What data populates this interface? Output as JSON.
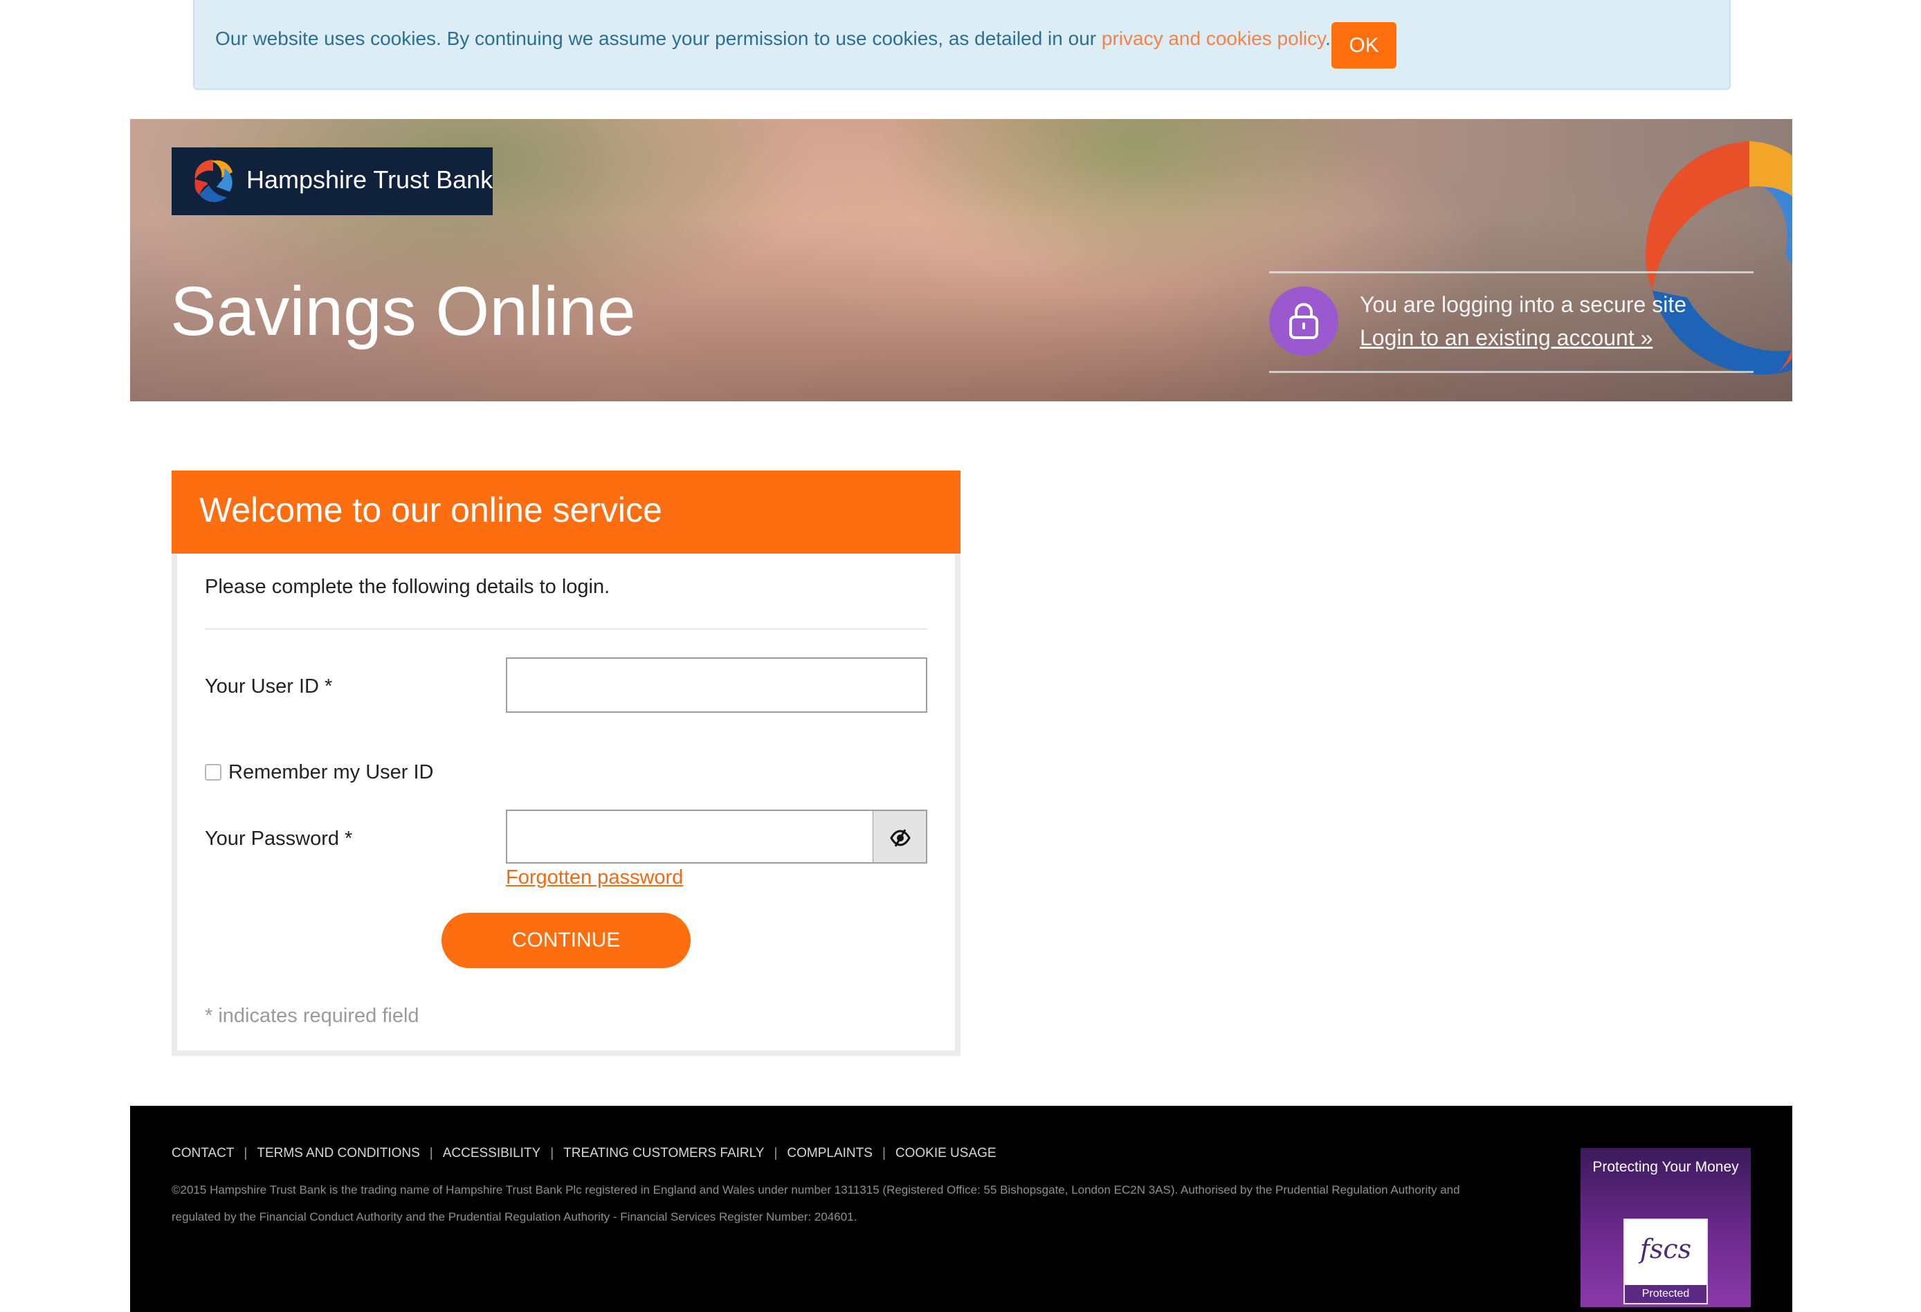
{
  "cookie_banner": {
    "message": "Our website uses cookies. By continuing we assume your permission to use cookies, as detailed in our ",
    "policy_link": "privacy and cookies policy",
    "trailing": ".",
    "ok_label": "OK"
  },
  "hero": {
    "brand_name": "Hampshire Trust Bank",
    "title": "Savings Online",
    "secure_text": "You are logging into a secure site",
    "login_link": "Login to an existing account »"
  },
  "login_panel": {
    "heading": "Welcome to our online service",
    "intro": "Please complete the following details to login.",
    "user_id_label": "Your User ID *",
    "user_id_value": "",
    "remember_label": "Remember my User ID",
    "remember_checked": false,
    "password_label": "Your Password *",
    "password_value": "",
    "forgot_link": "Forgotten password",
    "continue_label": "CONTINUE",
    "required_note": "* indicates required field"
  },
  "footer": {
    "nav": [
      "CONTACT",
      "TERMS AND CONDITIONS",
      "ACCESSIBILITY",
      "TREATING CUSTOMERS FAIRLY",
      "COMPLAINTS",
      "COOKIE USAGE"
    ],
    "legal": "©2015 Hampshire Trust Bank is the trading name of Hampshire Trust Bank Plc registered in England and Wales under number 1311315 (Registered Office: 55 Bishopsgate, London EC2N 3AS). Authorised by the Prudential Regulation Authority and regulated by the Financial Conduct Authority and the Prudential Regulation Authority - Financial Services Register Number: 204601.",
    "fscs_title": "Protecting Your Money",
    "fscs_logo": "fscs",
    "fscs_protected": "Protected"
  },
  "colors": {
    "accent_orange": "#fd6e11",
    "cookie_bg": "#dcedf5",
    "cookie_text": "#2b6f95",
    "brand_navy": "#10213c",
    "lock_purple": "#9b59d0"
  },
  "icons": {
    "brand_logo": "hampshire-swirl-icon",
    "lock": "lock-icon",
    "password_toggle": "eye-slash-icon"
  }
}
